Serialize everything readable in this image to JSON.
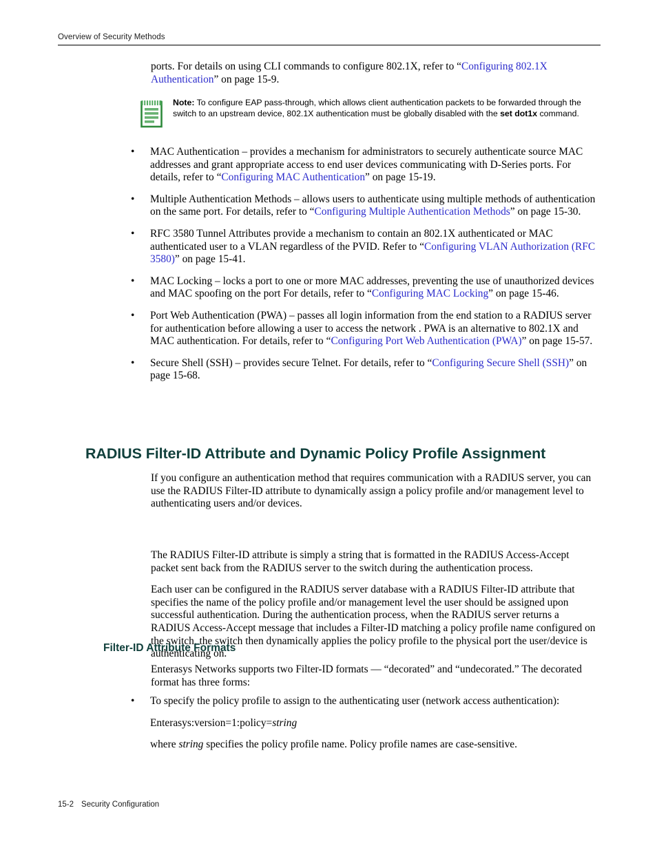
{
  "header": {
    "running_head": "Overview of Security Methods"
  },
  "intro_paragraph": {
    "before_link": "ports. For details on using CLI commands to configure 802.1X, refer to “",
    "link": "Configuring 802.1X Authentication",
    "after_link": "” on page 15-9."
  },
  "note": {
    "icon": "notepad-icon",
    "label": "Note:",
    "text_part_1": " To configure EAP pass-through, which allows client authentication packets to be forwarded through the switch to an upstream device, 802.1X authentication must be globally disabled with the ",
    "command": "set dot1x",
    "text_part_2": " command."
  },
  "bullets": [
    {
      "marker": "•",
      "before_link": "MAC Authentication – provides a mechanism for administrators to securely authenticate source MAC addresses and grant appropriate access to end user devices communicating with D-Series ports. For details, refer to “",
      "link": "Configuring MAC Authentication",
      "after_link": "” on page 15-19."
    },
    {
      "marker": "•",
      "before_link": "Multiple Authentication Methods – allows users to authenticate using multiple methods of authentication on the same port. For details, refer to “",
      "link": "Configuring Multiple Authentication Methods",
      "after_link": "” on page 15-30."
    },
    {
      "marker": "•",
      "before_link": "RFC 3580 Tunnel Attributes provide a mechanism to contain an 802.1X authenticated or MAC authenticated user to a VLAN regardless of the PVID.   Refer to “",
      "link": "Configuring VLAN Authorization (RFC 3580)",
      "after_link": "” on page 15-41."
    },
    {
      "marker": "•",
      "before_link": "MAC Locking – locks a port to one or more MAC addresses, preventing the use of unauthorized devices and MAC spoofing on the port For details, refer to “",
      "link": "Configuring MAC Locking",
      "after_link": "” on page 15-46."
    },
    {
      "marker": "•",
      "before_link": "Port Web Authentication (PWA) – passes all login information from the end station to a RADIUS server for authentication before allowing a user to access the network . PWA is an alternative to 802.1X and MAC authentication. For details, refer to “",
      "link": "Configuring Port Web Authentication (PWA)",
      "after_link": "” on page 15-57."
    },
    {
      "marker": "•",
      "before_link": "Secure Shell (SSH) – provides secure Telnet. For details, refer to “",
      "link": "Configuring Secure Shell (SSH)",
      "after_link": "” on page 15-68."
    }
  ],
  "section_heading": "RADIUS Filter-ID Attribute and Dynamic Policy Profile Assignment",
  "section_paragraphs": [
    "If you configure an authentication method that requires communication with a RADIUS server, you can use the RADIUS Filter-ID attribute to dynamically assign a policy profile and/or management level to authenticating users and/or devices.",
    "The RADIUS Filter-ID attribute is simply a string that is formatted in the RADIUS Access-Accept packet sent back from the RADIUS server to the switch during the authentication process.",
    "Each user can be configured in the RADIUS server database with a RADIUS Filter-ID attribute that specifies the name of the policy profile and/or management level the user should be assigned upon successful authentication. During the authentication process, when the RADIUS server returns a RADIUS Access-Accept message that includes a Filter-ID matching a policy profile name configured on the switch, the switch then dynamically applies the policy profile to the physical port the user/device is authenticating on."
  ],
  "subsection_heading": "Filter-ID Attribute Formats",
  "subsection_intro": "Enterasys Networks supports two Filter-ID formats — “decorated” and “undecorated.” The decorated format has three forms:",
  "format_bullet": {
    "marker": "•",
    "text": "To specify the policy profile to assign to the authenticating user (network access authentication):"
  },
  "format_code": {
    "prefix": "Enterasys:version=1:policy=",
    "variable": "string"
  },
  "format_note": {
    "before_variable": "where ",
    "variable": "string",
    "after_variable": " specifies the policy profile name. Policy profile names are case-sensitive."
  },
  "footer": {
    "page_number": "15-2",
    "chapter_title": "Security Configuration"
  },
  "colors": {
    "link": "#2c2ccc",
    "heading": "#11403c",
    "note_icon_green": "#3a9b46",
    "rule": "#000000"
  }
}
